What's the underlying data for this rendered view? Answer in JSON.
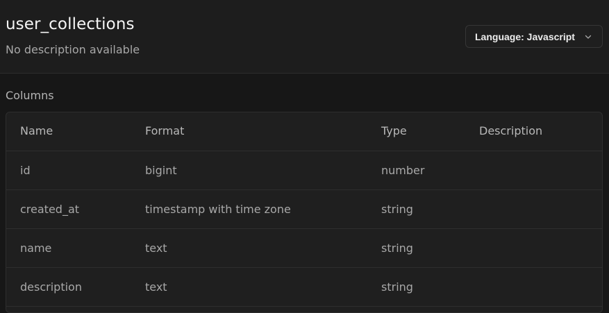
{
  "header": {
    "title": "user_collections",
    "description": "No description available",
    "language_select": {
      "label": "Language: Javascript",
      "icon": "chevron-down-icon"
    }
  },
  "columns_section": {
    "label": "Columns",
    "headers": {
      "name": "Name",
      "format": "Format",
      "type": "Type",
      "description": "Description"
    },
    "rows": [
      {
        "name": "id",
        "format": "bigint",
        "type": "number",
        "description": ""
      },
      {
        "name": "created_at",
        "format": "timestamp with time zone",
        "type": "string",
        "description": ""
      },
      {
        "name": "name",
        "format": "text",
        "type": "string",
        "description": ""
      },
      {
        "name": "description",
        "format": "text",
        "type": "string",
        "description": ""
      }
    ]
  },
  "colors": {
    "background": "#171717",
    "header_background": "#1d1d1d",
    "table_background": "#1f1f1f",
    "border": "#2e2e2e"
  }
}
